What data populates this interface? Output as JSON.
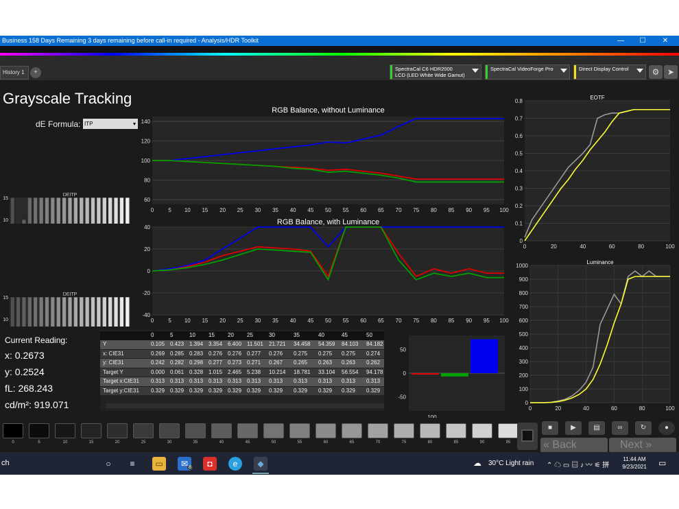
{
  "window": {
    "title": "Business 158 Days Remaining 3 days remaining before call-in required - Analysis/HDR Toolkit",
    "min": "—",
    "max": "☐",
    "close": "✕"
  },
  "tabs": {
    "history": "History 1",
    "plus": "+"
  },
  "devices": [
    {
      "line1": "SpectraCal C6 HDR2000",
      "line2": "LCD (LED White Wide Gamut)",
      "color": "#2fd22f"
    },
    {
      "line1": "SpectraCal VideoForge Pro",
      "line2": "",
      "color": "#2fd22f"
    },
    {
      "line1": "Direct Display Control",
      "line2": "",
      "color": "#f0e020"
    }
  ],
  "page_title": "Grayscale Tracking",
  "de_formula": {
    "label": "dE Formula:",
    "value": "ITP"
  },
  "reading": {
    "header": "Current Reading:",
    "x": "x: 0.2673",
    "y": "y: 0.2524",
    "fl": "fL: 268.243",
    "cd": "cd/m²: 919.071"
  },
  "colors": {
    "red": "#e00000",
    "green": "#00a000",
    "blue": "#0000ee",
    "gray": "#999999",
    "yellow": "#ffff33"
  },
  "chart_data": [
    {
      "type": "bar",
      "title": "DEITP",
      "categories": [
        "0",
        "5",
        "10",
        "15",
        "20",
        "25",
        "30",
        "35",
        "40",
        "45",
        "50",
        "55",
        "60",
        "65",
        "70",
        "75",
        "80",
        "85",
        "90",
        "95",
        "100"
      ],
      "ylim": [
        0,
        15
      ],
      "yticks": [
        "0",
        "5",
        "10",
        "15"
      ],
      "values": [
        15,
        8,
        10,
        15,
        15,
        15,
        15,
        15,
        15,
        15,
        15,
        15,
        15,
        15,
        15,
        15,
        15,
        15,
        15,
        15,
        15
      ]
    },
    {
      "type": "bar",
      "title": "DEITP",
      "categories": [
        "0",
        "5",
        "10",
        "15",
        "20",
        "25",
        "30",
        "35",
        "40",
        "45",
        "50",
        "55",
        "60",
        "65",
        "70",
        "75",
        "80",
        "85",
        "90",
        "95",
        "100"
      ],
      "ylim": [
        0,
        15
      ],
      "yticks": [
        "0",
        "5",
        "10",
        "15"
      ],
      "values": [
        15,
        15,
        15,
        15,
        15,
        15,
        15,
        15,
        15,
        15,
        15,
        15,
        15,
        15,
        15,
        15,
        15,
        15,
        15,
        15,
        15
      ]
    },
    {
      "type": "line",
      "title": "RGB Balance, without Luminance",
      "x": [
        0,
        5,
        10,
        15,
        20,
        25,
        30,
        35,
        40,
        45,
        50,
        55,
        60,
        65,
        70,
        75,
        80,
        85,
        90,
        95,
        100
      ],
      "ylim": [
        55,
        145
      ],
      "yticks": [
        60,
        80,
        100,
        120,
        140
      ],
      "series": [
        {
          "color": "#0000ee",
          "values": [
            100,
            100,
            102,
            104,
            106,
            108,
            110,
            112,
            114,
            116,
            119,
            118,
            122,
            126,
            135,
            143,
            143,
            143,
            143,
            143,
            143
          ]
        },
        {
          "color": "#e00000",
          "values": [
            100,
            100,
            99,
            98,
            97,
            96,
            95,
            94,
            93,
            92,
            90,
            91,
            89,
            87,
            84,
            81,
            81,
            81,
            81,
            81,
            81
          ]
        },
        {
          "color": "#00a000",
          "values": [
            100,
            100,
            99,
            98,
            97,
            96,
            95,
            94,
            92,
            91,
            88,
            89,
            87,
            85,
            82,
            78,
            78,
            78,
            78,
            78,
            78
          ]
        }
      ]
    },
    {
      "type": "line",
      "title": "RGB Balance, with Luminance",
      "x": [
        0,
        5,
        10,
        15,
        20,
        25,
        30,
        35,
        40,
        45,
        50,
        55,
        60,
        65,
        70,
        75,
        80,
        85,
        90,
        95,
        100
      ],
      "ylim": [
        -40,
        40
      ],
      "yticks": [
        -40,
        -20,
        0,
        20,
        40
      ],
      "series": [
        {
          "color": "#0000ee",
          "values": [
            0,
            2,
            5,
            10,
            20,
            30,
            40,
            40,
            40,
            40,
            22,
            40,
            40,
            40,
            40,
            40,
            40,
            40,
            40,
            40,
            40
          ]
        },
        {
          "color": "#e00000",
          "values": [
            0,
            1,
            4,
            8,
            14,
            18,
            22,
            21,
            20,
            18,
            -5,
            40,
            40,
            40,
            16,
            -5,
            2,
            -2,
            2,
            -2,
            -2
          ]
        },
        {
          "color": "#00a000",
          "values": [
            0,
            1,
            3,
            6,
            10,
            15,
            20,
            19,
            18,
            17,
            -8,
            40,
            40,
            40,
            10,
            -8,
            -2,
            -5,
            -2,
            -6,
            -6
          ]
        }
      ]
    },
    {
      "type": "line",
      "title": "EOTF",
      "x": [
        0,
        5,
        10,
        15,
        20,
        25,
        30,
        35,
        40,
        45,
        50,
        55,
        60,
        65,
        70,
        75,
        80,
        85,
        90,
        95,
        100
      ],
      "ylim": [
        0,
        0.8
      ],
      "yticks": [
        "0",
        "0.1",
        "0.2",
        "0.3",
        "0.4",
        "0.5",
        "0.6",
        "0.7",
        "0.8"
      ],
      "series": [
        {
          "color": "#999999",
          "values": [
            0.02,
            0.12,
            0.18,
            0.24,
            0.3,
            0.36,
            0.42,
            0.46,
            0.5,
            0.55,
            0.7,
            0.72,
            0.73,
            0.73,
            0.74,
            0.75,
            0.75,
            0.75,
            0.75,
            0.75,
            0.75
          ]
        },
        {
          "color": "#ffff33",
          "values": [
            0,
            0.06,
            0.12,
            0.18,
            0.24,
            0.3,
            0.35,
            0.41,
            0.46,
            0.52,
            0.57,
            0.62,
            0.68,
            0.73,
            0.74,
            0.75,
            0.75,
            0.75,
            0.75,
            0.75,
            0.75
          ]
        }
      ]
    },
    {
      "type": "line",
      "title": "Luminance",
      "x": [
        0,
        5,
        10,
        15,
        20,
        25,
        30,
        35,
        40,
        45,
        50,
        55,
        60,
        65,
        70,
        75,
        80,
        85,
        90,
        95,
        100
      ],
      "ylim": [
        0,
        1000
      ],
      "yticks": [
        "0",
        "100",
        "200",
        "300",
        "400",
        "500",
        "600",
        "700",
        "800",
        "900",
        "1000"
      ],
      "series": [
        {
          "color": "#999999",
          "values": [
            0,
            0,
            0,
            3,
            12,
            25,
            50,
            90,
            150,
            260,
            570,
            680,
            790,
            720,
            920,
            960,
            920,
            960,
            920,
            920,
            920
          ]
        },
        {
          "color": "#ffff33",
          "values": [
            0,
            0,
            0,
            2,
            8,
            18,
            35,
            60,
            100,
            170,
            280,
            420,
            580,
            720,
            900,
            920,
            920,
            920,
            920,
            920,
            920
          ]
        }
      ]
    },
    {
      "type": "bar",
      "categories": [
        "R",
        "G",
        "B"
      ],
      "ylim": [
        -80,
        80
      ],
      "yticks": [
        -50,
        0,
        50
      ],
      "xlabel": "100",
      "values": [
        -3,
        -7,
        72
      ],
      "colors": [
        "#e00000",
        "#00a000",
        "#0000ee"
      ]
    }
  ],
  "table": {
    "headers": [
      "",
      "0",
      "5",
      "10",
      "15",
      "20",
      "25",
      "30",
      "35",
      "40",
      "45",
      "50"
    ],
    "rows": [
      {
        "label": "Y",
        "cells": [
          "0.105",
          "0.423",
          "1.394",
          "3.354",
          "6.400",
          "11.501",
          "21.721",
          "34.458",
          "54.359",
          "84.103",
          "84.182"
        ]
      },
      {
        "label": "x: CIE31",
        "cells": [
          "0.269",
          "0.285",
          "0.283",
          "0.276",
          "0.276",
          "0.277",
          "0.276",
          "0.275",
          "0.275",
          "0.275",
          "0.274"
        ]
      },
      {
        "label": "y: CIE31",
        "cells": [
          "0.242",
          "0.282",
          "0.298",
          "0.277",
          "0.273",
          "0.271",
          "0.267",
          "0.265",
          "0.263",
          "0.263",
          "0.262"
        ]
      },
      {
        "label": "Target Y",
        "cells": [
          "0.000",
          "0.061",
          "0.328",
          "1.015",
          "2.465",
          "5.238",
          "10.214",
          "18.781",
          "33.104",
          "56.554",
          "94.178"
        ]
      },
      {
        "label": "Target x:CIE31",
        "cells": [
          "0.313",
          "0.313",
          "0.313",
          "0.313",
          "0.313",
          "0.313",
          "0.313",
          "0.313",
          "0.313",
          "0.313",
          "0.313"
        ]
      },
      {
        "label": "Target y:CIE31",
        "cells": [
          "0.329",
          "0.329",
          "0.329",
          "0.329",
          "0.329",
          "0.329",
          "0.329",
          "0.329",
          "0.329",
          "0.329",
          "0.329"
        ]
      }
    ]
  },
  "swatches": [
    "0",
    "5",
    "10",
    "15",
    "20",
    "25",
    "30",
    "35",
    "40",
    "45",
    "50",
    "55",
    "60",
    "65",
    "70",
    "75",
    "80",
    "85",
    "90",
    "95"
  ],
  "nav": {
    "back": "Back",
    "next": "Next"
  },
  "taskbar": {
    "search": "ch",
    "weather": "30°C  Light rain",
    "time": "11:44 AM",
    "date": "9/23/2021",
    "badge": "8"
  }
}
